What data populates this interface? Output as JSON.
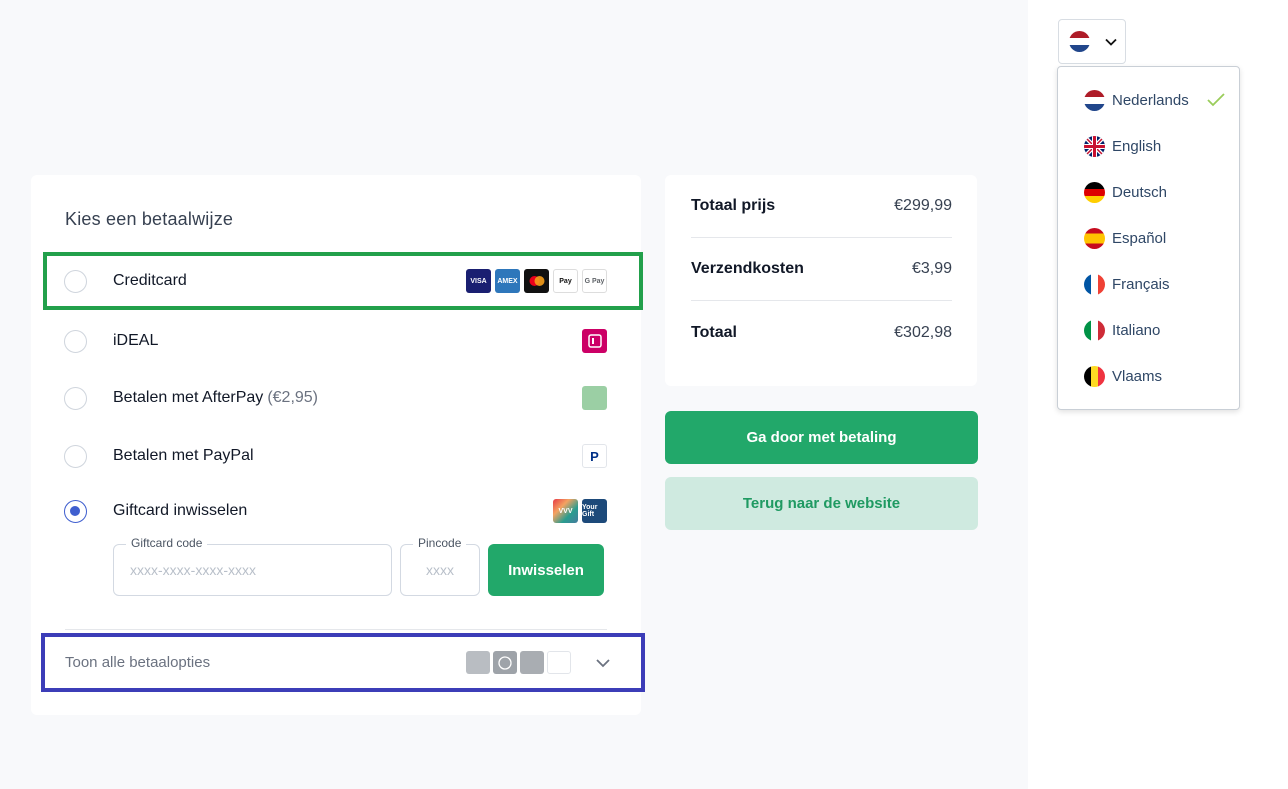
{
  "payment": {
    "title": "Kies een betaalwijze",
    "methods": [
      {
        "label": "Creditcard",
        "fee": "",
        "selected": false,
        "logos": [
          "visa-logo",
          "amex-logo",
          "mastercard-logo",
          "apple-pay-logo",
          "google-pay-logo"
        ]
      },
      {
        "label": "iDEAL",
        "fee": "",
        "selected": false,
        "logos": [
          "ideal-logo"
        ]
      },
      {
        "label": "Betalen met AfterPay",
        "fee": "(€2,95)",
        "selected": false,
        "logos": [
          "afterpay-logo"
        ]
      },
      {
        "label": "Betalen met PayPal",
        "fee": "",
        "selected": false,
        "logos": [
          "paypal-logo"
        ]
      },
      {
        "label": "Giftcard inwisselen",
        "fee": "",
        "selected": true,
        "logos": [
          "vvv-giftcard-logo",
          "yourgift-logo"
        ]
      }
    ],
    "giftcard": {
      "code_label": "Giftcard code",
      "code_placeholder": "xxxx-xxxx-xxxx-xxxx",
      "code_value": "",
      "pin_label": "Pincode",
      "pin_placeholder": "xxxx",
      "pin_value": "",
      "redeem_label": "Inwisselen"
    },
    "show_all_label": "Toon alle betaalopties",
    "more_logos": [
      "banktransfer-logo",
      "euro-logo",
      "alipay-logo",
      "amazon-pay-logo"
    ]
  },
  "summary": {
    "rows": [
      {
        "label": "Totaal prijs",
        "value": "€299,99"
      },
      {
        "label": "Verzendkosten",
        "value": "€3,99"
      },
      {
        "label": "Totaal",
        "value": "€302,98"
      }
    ]
  },
  "actions": {
    "continue_label": "Ga door met betaling",
    "back_label": "Terug naar de website"
  },
  "language": {
    "current_flag": "nl-flag-icon",
    "options": [
      {
        "name": "Nederlands",
        "flag": "nl-flag-icon",
        "selected": true
      },
      {
        "name": "English",
        "flag": "uk-flag-icon",
        "selected": false
      },
      {
        "name": "Deutsch",
        "flag": "de-flag-icon",
        "selected": false
      },
      {
        "name": "Español",
        "flag": "es-flag-icon",
        "selected": false
      },
      {
        "name": "Français",
        "flag": "fr-flag-icon",
        "selected": false
      },
      {
        "name": "Italiano",
        "flag": "it-flag-icon",
        "selected": false
      },
      {
        "name": "Vlaams",
        "flag": "be-flag-icon",
        "selected": false
      }
    ]
  },
  "colors": {
    "primary_green": "#22a86a",
    "highlight_green": "#22a04b",
    "highlight_blue": "#3c3db8",
    "radio_selected": "#3f5fcf"
  }
}
